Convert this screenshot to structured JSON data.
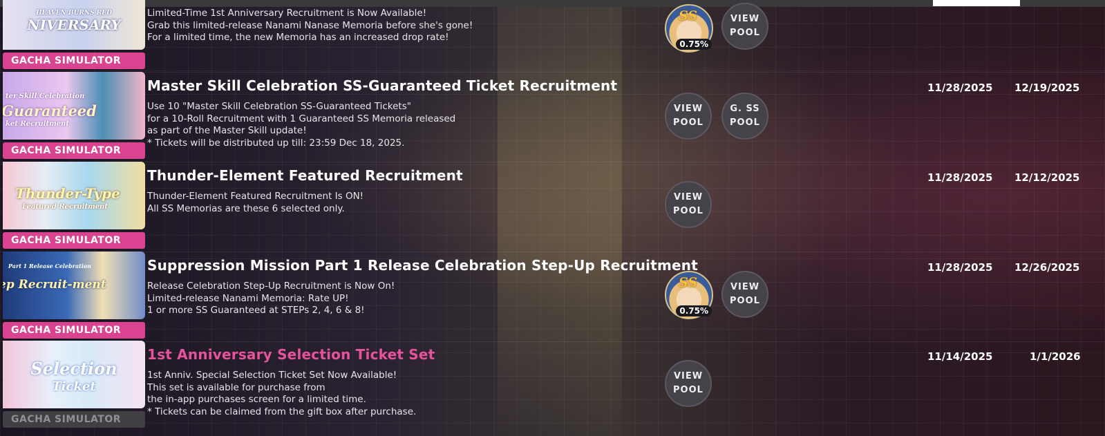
{
  "rows": [
    {
      "banner_text": "NIVERSARY",
      "banner_top_text": "HEAVEN BURNS RED",
      "title": "",
      "desc": [
        "Limited-Time 1st Anniversary Recruitment is Now Available!",
        "Grab this limited-release Nanami Nanase Memoria before she's gone!",
        "For a limited time, the new Memoria has an increased drop rate!"
      ],
      "label": "GACHA SIMULATOR",
      "rate": "0.75%",
      "rate_badge": "SS",
      "buttons": [
        "VIEW POOL"
      ]
    },
    {
      "banner_text": "Guaranteed",
      "banner_top_text": "ter Skill Celebration",
      "banner_sub_text": "ket Recruitment",
      "title": "Master Skill Celebration SS-Guaranteed Ticket Recruitment",
      "desc": [
        "Use 10 \"Master Skill Celebration SS-Guaranteed Tickets\"",
        "for a 10-Roll Recruitment with 1 Guaranteed SS Memoria released",
        "as part of the Master Skill update!",
        "* Tickets will be distributed up till: 23:59 Dec 18, 2025."
      ],
      "label": "GACHA SIMULATOR",
      "buttons": [
        "VIEW POOL",
        "G. SS POOL"
      ],
      "start": "11/28/2025",
      "end": "12/19/2025"
    },
    {
      "banner_text": "Thunder-Type",
      "banner_sub_text": "Featured Recruitment",
      "title": "Thunder-Element Featured Recruitment",
      "desc": [
        "Thunder-Element Featured Recruitment Is ON!",
        "All SS Memorias are these 6 selected only."
      ],
      "label": "GACHA SIMULATOR",
      "buttons": [
        "VIEW POOL"
      ],
      "start": "11/28/2025",
      "end": "12/12/2025"
    },
    {
      "banner_text": "ep Recruit-ment",
      "banner_top_text": "Part 1  Release Celebration",
      "title": "Suppression Mission Part 1 Release Celebration Step-Up Recruitment",
      "desc": [
        "Release Celebration Step-Up Recruitment is Now On!",
        "Limited-release Nanami Memoria: Rate UP!",
        "1 or more SS Guaranteed at STEPs 2, 4, 6 & 8!"
      ],
      "label": "GACHA SIMULATOR",
      "rate": "0.75%",
      "rate_badge": "SS",
      "buttons": [
        "VIEW POOL"
      ],
      "start": "11/28/2025",
      "end": "12/26/2025"
    },
    {
      "banner_text": "Selection",
      "banner_sub_text": "Ticket",
      "title": "1st Anniversary Selection Ticket Set",
      "desc": [
        "1st Anniv. Special Selection Ticket Set Now Available!",
        "This set is available for purchase from",
        "the in-app purchases screen for a limited time.",
        "* Tickets can be claimed from the gift box after purchase."
      ],
      "label": "GACHA SIMULATOR",
      "buttons": [
        "VIEW POOL"
      ],
      "start": "11/14/2025",
      "end": "1/1/2026"
    }
  ],
  "colors": {
    "accent": "#d9438f",
    "title_pink": "#e6529c",
    "button_bg": "#46424a"
  }
}
